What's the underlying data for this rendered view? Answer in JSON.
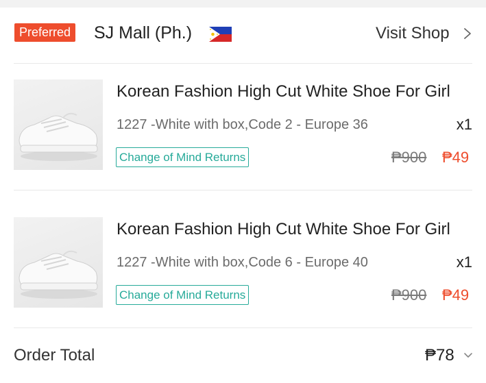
{
  "shop": {
    "badge": "Preferred",
    "name": "SJ Mall (Ph.)",
    "flag_icon": "philippines-flag-icon",
    "visit_label": "Visit Shop",
    "chevron_icon": "chevron-right-icon"
  },
  "items": [
    {
      "title": "Korean Fashion High Cut White Shoe For Girl",
      "variant": "1227 -White with box,Code 2 - Europe 36",
      "quantity": "x1",
      "returns_label": "Change of Mind Returns",
      "original_price": "₱900",
      "sale_price": "₱49",
      "image_icon": "white-sneaker-image"
    },
    {
      "title": "Korean Fashion High Cut White Shoe For Girl",
      "variant": "1227 -White with box,Code 6 - Europe 40",
      "quantity": "x1",
      "returns_label": "Change of Mind Returns",
      "original_price": "₱900",
      "sale_price": "₱49",
      "image_icon": "white-sneaker-image"
    }
  ],
  "order": {
    "total_label": "Order Total",
    "total_value": "₱78",
    "chevron_icon": "chevron-down-icon"
  },
  "colors": {
    "accent": "#ee4d2d",
    "returns": "#26aa99",
    "muted": "#6b6b6b"
  }
}
